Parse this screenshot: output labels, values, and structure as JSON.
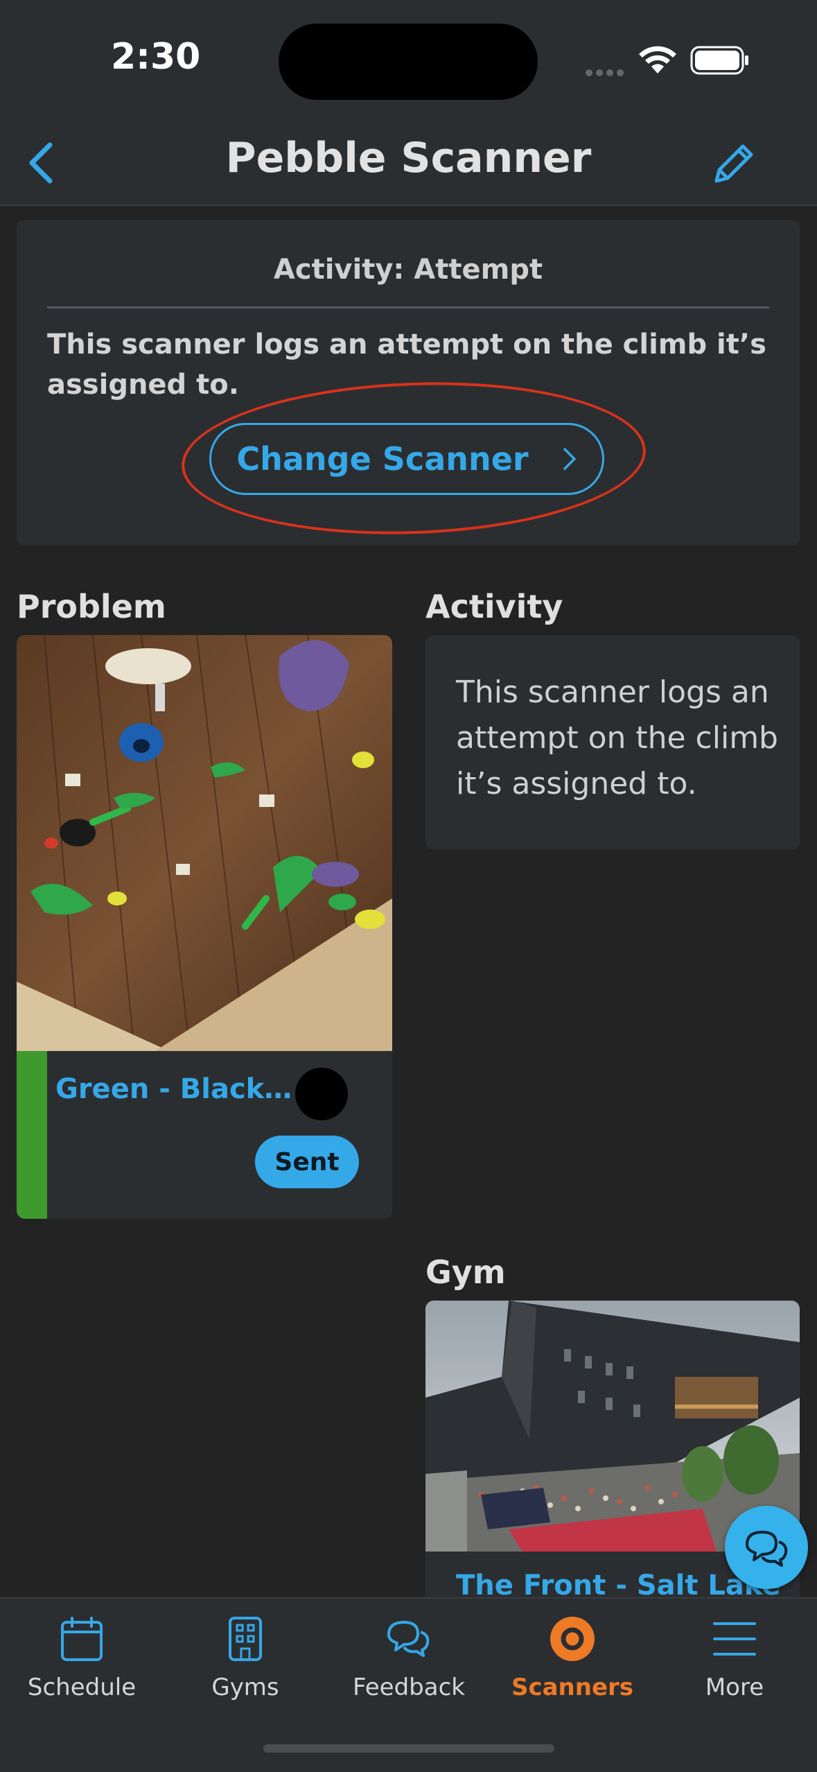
{
  "status_bar": {
    "time": "2:30"
  },
  "header": {
    "title": "Pebble Scanner"
  },
  "activity_card": {
    "heading": "Activity: Attempt",
    "description": "This scanner logs an attempt on the climb it’s assigned to.",
    "button_label": "Change Scanner"
  },
  "problem": {
    "section_label": "Problem",
    "name": "Green - Black D...",
    "status_badge": "Sent",
    "stripe_color": "#3e9a2c",
    "hold_color": "#000000"
  },
  "activity": {
    "section_label": "Activity",
    "description": "This scanner logs an attempt on the climb it’s assigned to."
  },
  "gym": {
    "section_label": "Gym",
    "name": "The Front - Salt Lake"
  },
  "tab_bar": {
    "tabs": [
      {
        "label": "Schedule",
        "icon": "calendar-icon"
      },
      {
        "label": "Gyms",
        "icon": "building-icon"
      },
      {
        "label": "Feedback",
        "icon": "chat-bubbles-icon"
      },
      {
        "label": "Scanners",
        "icon": "scanner-icon",
        "active": true
      },
      {
        "label": "More",
        "icon": "menu-icon"
      }
    ]
  },
  "colors": {
    "accent": "#35a8e8",
    "active_tab": "#ee7a26",
    "annotation": "#d9321b",
    "background": "#232323",
    "card": "#2b2e31"
  }
}
